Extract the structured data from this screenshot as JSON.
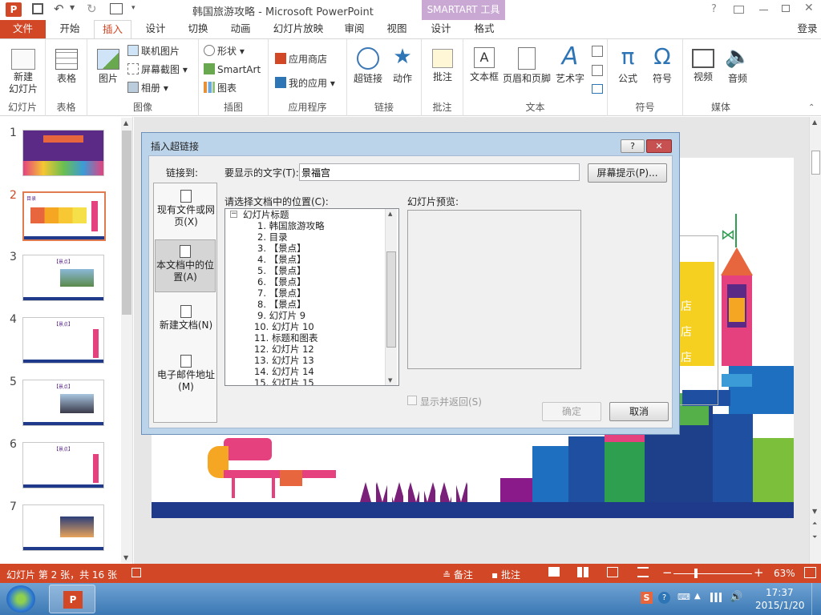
{
  "title_bar": {
    "app_title": "韩国旅游攻略 - Microsoft PowerPoint",
    "context_tool": "SMARTART 工具",
    "help": "?",
    "login": "登录"
  },
  "tabs": [
    "文件",
    "开始",
    "插入",
    "设计",
    "切换",
    "动画",
    "幻灯片放映",
    "审阅",
    "视图",
    "设计",
    "格式"
  ],
  "ribbon": {
    "groups": [
      {
        "label": "幻灯片",
        "buttons": [
          "新建\n幻灯片"
        ]
      },
      {
        "label": "表格",
        "buttons": [
          "表格"
        ]
      },
      {
        "label": "图像",
        "buttons": [
          "图片",
          "联机图片",
          "屏幕截图",
          "相册"
        ]
      },
      {
        "label": "插图",
        "buttons": [
          "形状",
          "SmartArt",
          "图表"
        ]
      },
      {
        "label": "应用程序",
        "buttons": [
          "应用商店",
          "我的应用"
        ]
      },
      {
        "label": "链接",
        "buttons": [
          "超链接",
          "动作"
        ]
      },
      {
        "label": "批注",
        "buttons": [
          "批注"
        ]
      },
      {
        "label": "文本",
        "buttons": [
          "文本框",
          "页眉和页脚",
          "艺术字"
        ]
      },
      {
        "label": "符号",
        "buttons": [
          "公式",
          "符号"
        ]
      },
      {
        "label": "媒体",
        "buttons": [
          "视频",
          "音频"
        ]
      }
    ]
  },
  "thumbnails": [
    "1",
    "2",
    "3",
    "4",
    "5",
    "6",
    "7"
  ],
  "thumb_heading": "【景点】",
  "thumb2_heading": "目录",
  "dialog": {
    "title": "插入超链接",
    "help": "?",
    "link_to": "链接到:",
    "display_text_label": "要显示的文字(T):",
    "display_text_value": "景福宫",
    "screentip_button": "屏幕提示(P)...",
    "location_label": "请选择文档中的位置(C):",
    "preview_label": "幻灯片预览:",
    "link_options": [
      "现有文件或网\n页(X)",
      "本文档中的位\n置(A)",
      "新建文档(N)",
      "电子邮件地址\n(M)"
    ],
    "tree_root": "幻灯片标题",
    "tree_items": [
      "1.  韩国旅游攻略",
      "2.  目录",
      "3.  【景点】",
      "4.  【景点】",
      "5.  【景点】",
      "6.  【景点】",
      "7.  【景点】",
      "8.  【景点】",
      "9.  幻灯片 9",
      "10.  幻灯片 10",
      "11.  标题和图表",
      "12.  幻灯片 12",
      "13.  幻灯片 13",
      "14.  幻灯片 14",
      "15.  幻灯片 15"
    ],
    "show_return": "显示并返回(S)",
    "ok": "确定",
    "cancel": "取消"
  },
  "slide_partial_text": [
    "店",
    "店",
    "店"
  ],
  "status_bar": {
    "slide_info": "幻灯片 第 2 张，共 16 张",
    "notes": "备注",
    "comments": "批注",
    "zoom": "63%"
  },
  "taskbar": {
    "time": "17:37",
    "date": "2015/1/20"
  },
  "colors": {
    "accent": "#d24726",
    "context": "#c9a8d3"
  }
}
